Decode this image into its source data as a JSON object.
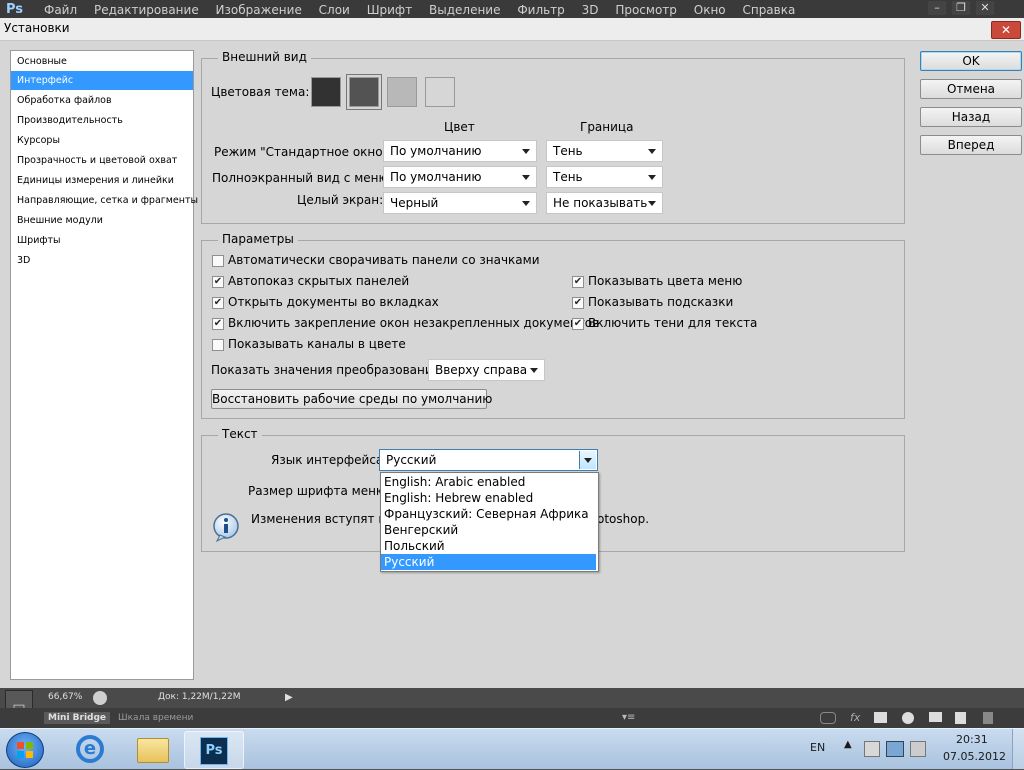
{
  "photoshop": {
    "logo": "Ps",
    "menu": [
      "Файл",
      "Редактирование",
      "Изображение",
      "Слои",
      "Шрифт",
      "Выделение",
      "Фильтр",
      "3D",
      "Просмотр",
      "Окно",
      "Справка"
    ],
    "status": {
      "zoom": "66,67%",
      "doc": "Док: 1,22M/1,22M",
      "tab_active": "Mini Bridge",
      "tab_other": "Шкала времени"
    }
  },
  "dialog": {
    "title": "Установки",
    "close": "✕",
    "nav": [
      "Основные",
      "Интерфейс",
      "Обработка файлов",
      "Производительность",
      "Курсоры",
      "Прозрачность и цветовой охват",
      "Единицы измерения и линейки",
      "Направляющие, сетка и фрагменты",
      "Внешние модули",
      "Шрифты",
      "3D"
    ],
    "nav_selected": 1,
    "buttons": {
      "ok": "OK",
      "cancel": "Отмена",
      "back": "Назад",
      "forward": "Вперед"
    },
    "appearance": {
      "title": "Внешний вид",
      "theme_label": "Цветовая тема:",
      "theme_colors": [
        "#323232",
        "#535353",
        "#b8b8b8",
        "#d6d6d6"
      ],
      "theme_selected": 1,
      "col_color": "Цвет",
      "col_border": "Граница",
      "rows": [
        {
          "label": "Режим \"Стандартное окно\":",
          "color": "По умолчанию",
          "border": "Тень"
        },
        {
          "label": "Полноэкранный вид с меню:",
          "color": "По умолчанию",
          "border": "Тень"
        },
        {
          "label": "Целый экран:",
          "color": "Черный",
          "border": "Не показывать"
        }
      ]
    },
    "params": {
      "title": "Параметры",
      "checks": [
        {
          "label": "Автоматически сворачивать панели со значками",
          "checked": false
        },
        {
          "label": "Автопоказ скрытых панелей",
          "checked": true
        },
        {
          "label": "Открыть документы во вкладках",
          "checked": true
        },
        {
          "label": "Включить закрепление окон незакрепленных документов",
          "checked": true
        },
        {
          "label": "Показывать каналы в цвете",
          "checked": false
        },
        {
          "label": "Показывать цвета меню",
          "checked": true
        },
        {
          "label": "Показывать подсказки",
          "checked": true
        },
        {
          "label": "Включить тени для текста",
          "checked": true
        }
      ],
      "transform_label": "Показать значения преобразования:",
      "transform_value": "Вверху справа",
      "reset_button": "Восстановить рабочие среды по умолчанию"
    },
    "text": {
      "title": "Текст",
      "lang_label": "Язык интерфейса:",
      "lang_value": "Русский",
      "fontsize_label": "Размер шрифта меню:",
      "info_left": "Изменения вступят в с",
      "info_right": "otoshop.",
      "lang_options": [
        "English: Arabic enabled",
        "English: Hebrew enabled",
        "Французский: Северная Африка",
        "Венгерский",
        "Польский",
        "Русский"
      ],
      "lang_selected": 5
    }
  },
  "taskbar": {
    "lang": "EN",
    "time": "20:31",
    "date": "07.05.2012"
  }
}
